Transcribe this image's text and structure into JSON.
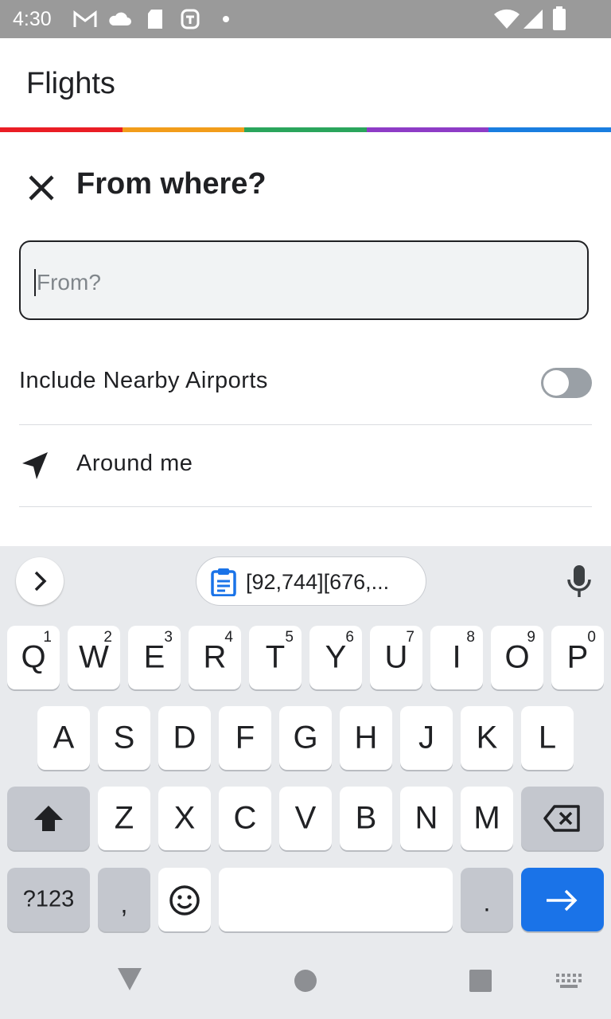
{
  "status_bar": {
    "time": "4:30",
    "left_icons": [
      "gmail-icon",
      "cloud-icon",
      "sd-card-icon",
      "accessibility-icon",
      "dot-icon"
    ],
    "right_icons": [
      "wifi-icon",
      "signal-icon",
      "battery-icon"
    ]
  },
  "app_bar": {
    "title": "Flights"
  },
  "stripe_colors": [
    "#ea1d25",
    "#f29d1b",
    "#2aa55c",
    "#8e3cc6",
    "#1a7ee0"
  ],
  "dialog": {
    "title": "From where?",
    "input_placeholder": "From?",
    "input_value": ""
  },
  "options": {
    "nearby_label": "Include Nearby Airports",
    "nearby_enabled": false,
    "around_me_label": "Around me"
  },
  "keyboard": {
    "clipboard_text": "[92,744][676,...",
    "row1": [
      {
        "key": "Q",
        "hint": "1"
      },
      {
        "key": "W",
        "hint": "2"
      },
      {
        "key": "E",
        "hint": "3"
      },
      {
        "key": "R",
        "hint": "4"
      },
      {
        "key": "T",
        "hint": "5"
      },
      {
        "key": "Y",
        "hint": "6"
      },
      {
        "key": "U",
        "hint": "7"
      },
      {
        "key": "I",
        "hint": "8"
      },
      {
        "key": "O",
        "hint": "9"
      },
      {
        "key": "P",
        "hint": "0"
      }
    ],
    "row2": [
      "A",
      "S",
      "D",
      "F",
      "G",
      "H",
      "J",
      "K",
      "L"
    ],
    "row3": [
      "Z",
      "X",
      "C",
      "V",
      "B",
      "N",
      "M"
    ],
    "symbols_label": "?123",
    "comma_label": ",",
    "period_label": "."
  },
  "colors": {
    "accent": "#1a73e8",
    "keyboard_bg": "#e8eaed",
    "toggle_off": "#9aa0a6"
  }
}
